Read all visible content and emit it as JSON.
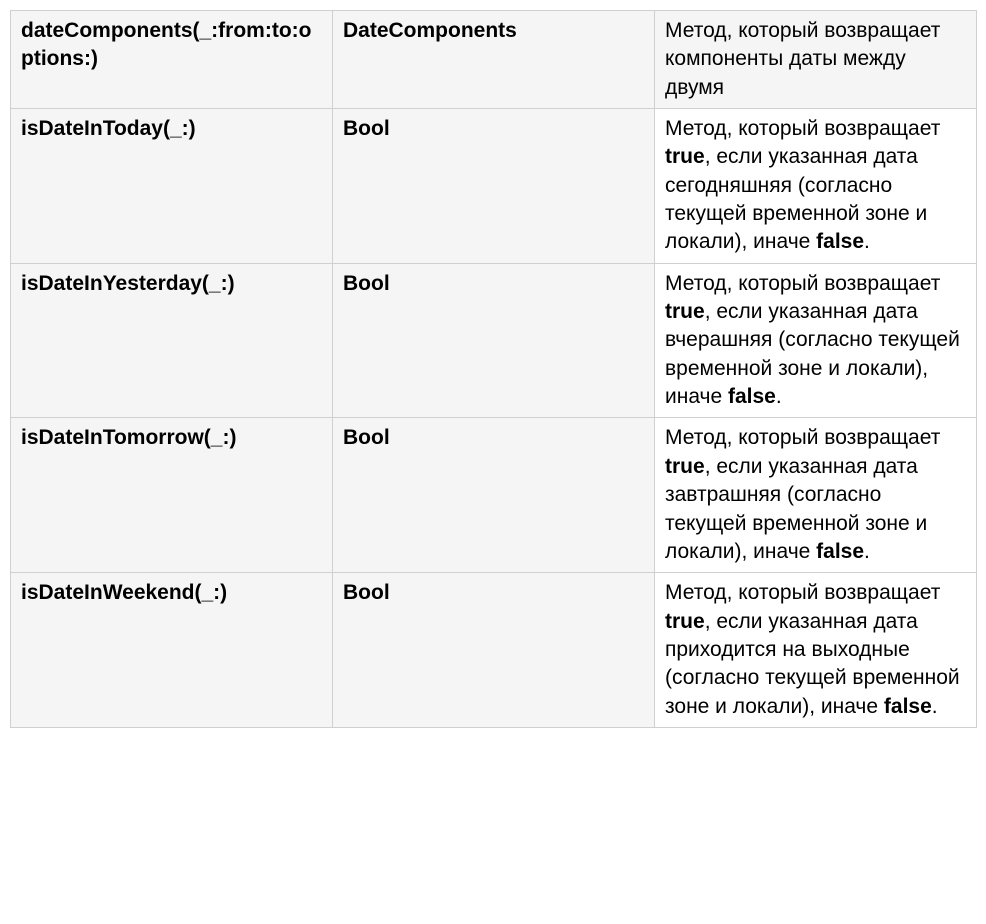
{
  "table": {
    "rows": [
      {
        "method": "dateComponents(_:from:to:options:)",
        "type": "DateComponents",
        "desc_parts": [
          "Метод, который возвращает компоненты даты между двумя"
        ]
      },
      {
        "method": "isDateInToday(_:)",
        "type": "Bool",
        "desc_parts": [
          "Метод, который возвращает ",
          "true",
          ", если указанная дата сегодняшняя (согласно текущей временной зоне и локали), иначе ",
          "false",
          "."
        ],
        "bold_idx": [
          1,
          3
        ]
      },
      {
        "method": "isDateInYesterday(_:)",
        "type": "Bool",
        "desc_parts": [
          "Метод, который возвращает ",
          "true",
          ", если указанная дата вчерашняя (согласно текущей временной зоне и локали), иначе ",
          "false",
          "."
        ],
        "bold_idx": [
          1,
          3
        ]
      },
      {
        "method": "isDateInTomorrow(_:)",
        "type": "Bool",
        "desc_parts": [
          "Метод, который возвращает ",
          "true",
          ", если указанная дата завтрашняя (согласно текущей временной зоне и локали), иначе ",
          "false",
          "."
        ],
        "bold_idx": [
          1,
          3
        ]
      },
      {
        "method": "isDateInWeekend(_:)",
        "type": "Bool",
        "desc_parts": [
          "Метод, который возвращает ",
          "true",
          ", если указанная дата приходится на выходные (согласно текущей временной зоне и локали), иначе ",
          "false",
          "."
        ],
        "bold_idx": [
          1,
          3
        ]
      }
    ]
  }
}
